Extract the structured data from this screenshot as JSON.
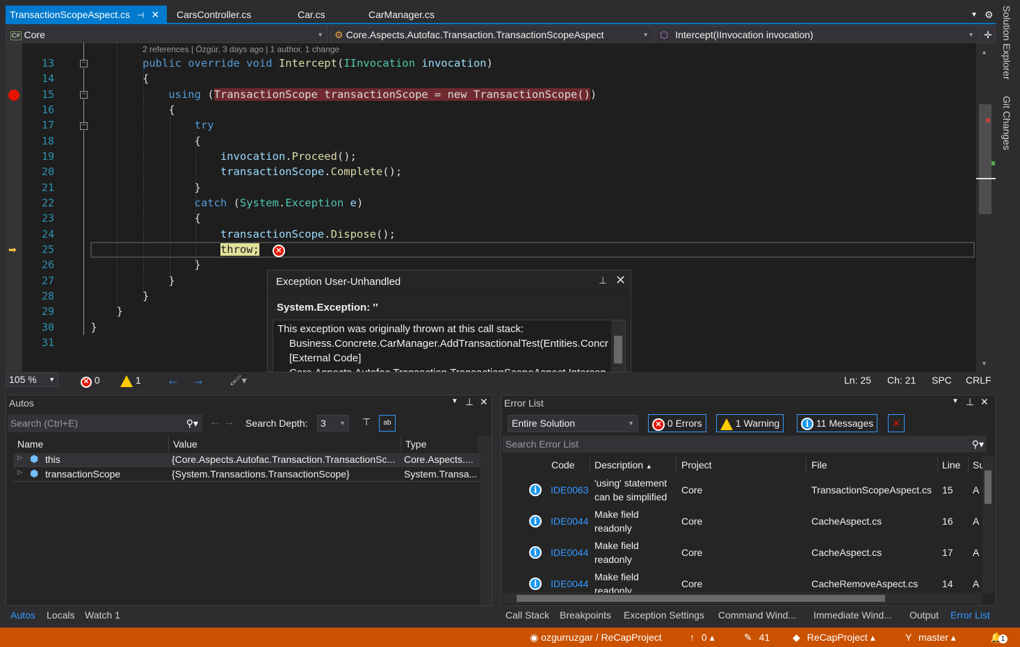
{
  "tabs": [
    {
      "label": "TransactionScopeAspect.cs",
      "active": true
    },
    {
      "label": "CarsController.cs"
    },
    {
      "label": "Car.cs"
    },
    {
      "label": "CarManager.cs"
    }
  ],
  "nav": {
    "project": "Core",
    "class": "Core.Aspects.Autofac.Transaction.TransactionScopeAspect",
    "member": "Intercept(IInvocation invocation)"
  },
  "codelens": "2 references | Özgür, 3 days ago | 1 author, 1 change",
  "code_lines": [
    {
      "n": "13",
      "indent": 0,
      "t": [
        [
          "public override void ",
          "kw"
        ],
        [
          "Intercept",
          "fn"
        ],
        [
          "(",
          "pl"
        ],
        [
          "IInvocation",
          "ty"
        ],
        [
          " invocation",
          "id"
        ],
        [
          ")",
          "pl"
        ]
      ]
    },
    {
      "n": "14",
      "indent": 0,
      "t": [
        [
          "{",
          "pl"
        ]
      ]
    },
    {
      "n": "15",
      "indent": 1,
      "t": [
        [
          "using",
          "kw"
        ],
        [
          " (",
          "pl"
        ],
        [
          "TransactionScope transactionScope = new TransactionScope()",
          "hlred"
        ],
        [
          ")",
          "pl"
        ]
      ]
    },
    {
      "n": "16",
      "indent": 1,
      "t": [
        [
          "{",
          "pl"
        ]
      ]
    },
    {
      "n": "17",
      "indent": 2,
      "t": [
        [
          "try",
          "kw"
        ]
      ]
    },
    {
      "n": "18",
      "indent": 2,
      "t": [
        [
          "{",
          "pl"
        ]
      ]
    },
    {
      "n": "19",
      "indent": 3,
      "t": [
        [
          "invocation",
          "id"
        ],
        [
          ".",
          "pl"
        ],
        [
          "Proceed",
          "fn"
        ],
        [
          "();",
          "pl"
        ]
      ]
    },
    {
      "n": "20",
      "indent": 3,
      "t": [
        [
          "transactionScope",
          "id"
        ],
        [
          ".",
          "pl"
        ],
        [
          "Complete",
          "fn"
        ],
        [
          "();",
          "pl"
        ]
      ]
    },
    {
      "n": "21",
      "indent": 2,
      "t": [
        [
          "}",
          "pl"
        ]
      ]
    },
    {
      "n": "22",
      "indent": 2,
      "t": [
        [
          "catch",
          "kw"
        ],
        [
          " (",
          "pl"
        ],
        [
          "System",
          "ty"
        ],
        [
          ".",
          "pl"
        ],
        [
          "Exception",
          "ty"
        ],
        [
          " e",
          "id"
        ],
        [
          ")",
          "pl"
        ]
      ]
    },
    {
      "n": "23",
      "indent": 2,
      "t": [
        [
          "{",
          "pl"
        ]
      ]
    },
    {
      "n": "24",
      "indent": 3,
      "t": [
        [
          "transactionScope",
          "id"
        ],
        [
          ".",
          "pl"
        ],
        [
          "Dispose",
          "fn"
        ],
        [
          "();",
          "pl"
        ]
      ]
    },
    {
      "n": "25",
      "indent": 3,
      "t": [
        [
          "throw;",
          "hlyel"
        ]
      ]
    },
    {
      "n": "26",
      "indent": 2,
      "t": [
        [
          "}",
          "pl"
        ]
      ]
    },
    {
      "n": "27",
      "indent": 1,
      "t": [
        [
          "}",
          "pl"
        ]
      ]
    },
    {
      "n": "28",
      "indent": 0,
      "t": [
        [
          "}",
          "pl"
        ]
      ]
    },
    {
      "n": "29",
      "indent": -1,
      "t": [
        [
          "}",
          "pl"
        ]
      ]
    },
    {
      "n": "30",
      "indent": -2,
      "t": [
        [
          "}",
          "pl"
        ]
      ]
    },
    {
      "n": "31",
      "indent": 0,
      "t": []
    }
  ],
  "exception": {
    "title": "Exception User-Unhandled",
    "type": "System.Exception: ''",
    "stack_header": "This exception was originally thrown at this call stack:",
    "stack": [
      "Business.Concrete.CarManager.AddTransactionalTest(Entities.Concr",
      "[External Code]",
      "Core.Aspects.Autofac.Transaction.TransactionScopeAspect.Intercep"
    ]
  },
  "editor_status": {
    "zoom": "105 %",
    "errors": "0",
    "warnings": "1",
    "ln": "Ln: 25",
    "ch": "Ch: 21",
    "spc": "SPC",
    "crlf": "CRLF"
  },
  "right_strip": [
    "Solution Explorer",
    "Git Changes"
  ],
  "autos": {
    "title": "Autos",
    "search_placeholder": "Search (Ctrl+E)",
    "search_depth_label": "Search Depth:",
    "search_depth": "3",
    "columns": [
      "Name",
      "Value",
      "Type"
    ],
    "rows": [
      {
        "name": "this",
        "value": "{Core.Aspects.Autofac.Transaction.TransactionSc...",
        "type": "Core.Aspects...."
      },
      {
        "name": "transactionScope",
        "value": "{System.Transactions.TransactionScope}",
        "type": "System.Transa..."
      }
    ],
    "tabs": [
      "Autos",
      "Locals",
      "Watch 1"
    ]
  },
  "errorlist": {
    "title": "Error List",
    "scope": "Entire Solution",
    "errors_btn": "0 Errors",
    "warnings_btn": "1 Warning",
    "messages_btn": "11 Messages",
    "search_placeholder": "Search Error List",
    "columns": [
      "Code",
      "Description",
      "Project",
      "File",
      "Line",
      "Su"
    ],
    "rows": [
      {
        "code": "IDE0063",
        "desc1": "'using' statement",
        "desc2": "can be simplified",
        "project": "Core",
        "file": "TransactionScopeAspect.cs",
        "line": "15",
        "s": "A"
      },
      {
        "code": "IDE0044",
        "desc1": "Make field",
        "desc2": "readonly",
        "project": "Core",
        "file": "CacheAspect.cs",
        "line": "16",
        "s": "A"
      },
      {
        "code": "IDE0044",
        "desc1": "Make field",
        "desc2": "readonly",
        "project": "Core",
        "file": "CacheAspect.cs",
        "line": "17",
        "s": "A"
      },
      {
        "code": "IDE0044",
        "desc1": "Make field",
        "desc2": "readonly",
        "project": "Core",
        "file": "CacheRemoveAspect.cs",
        "line": "14",
        "s": "A"
      }
    ]
  },
  "bottom_tabs": [
    "Call Stack",
    "Breakpoints",
    "Exception Settings",
    "Command Wind...",
    "Immediate Wind...",
    "Output",
    "Error List"
  ],
  "status": {
    "repo": "ozgurruzgar / ReCapProject",
    "push": "0",
    "changes": "41",
    "project": "ReCapProject",
    "branch": "master",
    "notifications": "1"
  },
  "colors": {
    "accent": "#007acc",
    "status_bar": "#ca5100",
    "line_number": "#2b91af",
    "keyword": "#569cd6",
    "type": "#4ec9b0"
  }
}
